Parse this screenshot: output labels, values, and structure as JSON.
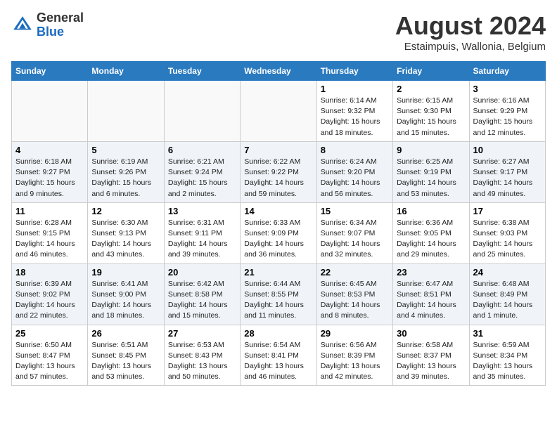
{
  "header": {
    "logo_general": "General",
    "logo_blue": "Blue",
    "month_year": "August 2024",
    "location": "Estaimpuis, Wallonia, Belgium"
  },
  "weekdays": [
    "Sunday",
    "Monday",
    "Tuesday",
    "Wednesday",
    "Thursday",
    "Friday",
    "Saturday"
  ],
  "weeks": [
    [
      {
        "day": "",
        "info": ""
      },
      {
        "day": "",
        "info": ""
      },
      {
        "day": "",
        "info": ""
      },
      {
        "day": "",
        "info": ""
      },
      {
        "day": "1",
        "info": "Sunrise: 6:14 AM\nSunset: 9:32 PM\nDaylight: 15 hours\nand 18 minutes."
      },
      {
        "day": "2",
        "info": "Sunrise: 6:15 AM\nSunset: 9:30 PM\nDaylight: 15 hours\nand 15 minutes."
      },
      {
        "day": "3",
        "info": "Sunrise: 6:16 AM\nSunset: 9:29 PM\nDaylight: 15 hours\nand 12 minutes."
      }
    ],
    [
      {
        "day": "4",
        "info": "Sunrise: 6:18 AM\nSunset: 9:27 PM\nDaylight: 15 hours\nand 9 minutes."
      },
      {
        "day": "5",
        "info": "Sunrise: 6:19 AM\nSunset: 9:26 PM\nDaylight: 15 hours\nand 6 minutes."
      },
      {
        "day": "6",
        "info": "Sunrise: 6:21 AM\nSunset: 9:24 PM\nDaylight: 15 hours\nand 2 minutes."
      },
      {
        "day": "7",
        "info": "Sunrise: 6:22 AM\nSunset: 9:22 PM\nDaylight: 14 hours\nand 59 minutes."
      },
      {
        "day": "8",
        "info": "Sunrise: 6:24 AM\nSunset: 9:20 PM\nDaylight: 14 hours\nand 56 minutes."
      },
      {
        "day": "9",
        "info": "Sunrise: 6:25 AM\nSunset: 9:19 PM\nDaylight: 14 hours\nand 53 minutes."
      },
      {
        "day": "10",
        "info": "Sunrise: 6:27 AM\nSunset: 9:17 PM\nDaylight: 14 hours\nand 49 minutes."
      }
    ],
    [
      {
        "day": "11",
        "info": "Sunrise: 6:28 AM\nSunset: 9:15 PM\nDaylight: 14 hours\nand 46 minutes."
      },
      {
        "day": "12",
        "info": "Sunrise: 6:30 AM\nSunset: 9:13 PM\nDaylight: 14 hours\nand 43 minutes."
      },
      {
        "day": "13",
        "info": "Sunrise: 6:31 AM\nSunset: 9:11 PM\nDaylight: 14 hours\nand 39 minutes."
      },
      {
        "day": "14",
        "info": "Sunrise: 6:33 AM\nSunset: 9:09 PM\nDaylight: 14 hours\nand 36 minutes."
      },
      {
        "day": "15",
        "info": "Sunrise: 6:34 AM\nSunset: 9:07 PM\nDaylight: 14 hours\nand 32 minutes."
      },
      {
        "day": "16",
        "info": "Sunrise: 6:36 AM\nSunset: 9:05 PM\nDaylight: 14 hours\nand 29 minutes."
      },
      {
        "day": "17",
        "info": "Sunrise: 6:38 AM\nSunset: 9:03 PM\nDaylight: 14 hours\nand 25 minutes."
      }
    ],
    [
      {
        "day": "18",
        "info": "Sunrise: 6:39 AM\nSunset: 9:02 PM\nDaylight: 14 hours\nand 22 minutes."
      },
      {
        "day": "19",
        "info": "Sunrise: 6:41 AM\nSunset: 9:00 PM\nDaylight: 14 hours\nand 18 minutes."
      },
      {
        "day": "20",
        "info": "Sunrise: 6:42 AM\nSunset: 8:58 PM\nDaylight: 14 hours\nand 15 minutes."
      },
      {
        "day": "21",
        "info": "Sunrise: 6:44 AM\nSunset: 8:55 PM\nDaylight: 14 hours\nand 11 minutes."
      },
      {
        "day": "22",
        "info": "Sunrise: 6:45 AM\nSunset: 8:53 PM\nDaylight: 14 hours\nand 8 minutes."
      },
      {
        "day": "23",
        "info": "Sunrise: 6:47 AM\nSunset: 8:51 PM\nDaylight: 14 hours\nand 4 minutes."
      },
      {
        "day": "24",
        "info": "Sunrise: 6:48 AM\nSunset: 8:49 PM\nDaylight: 14 hours\nand 1 minute."
      }
    ],
    [
      {
        "day": "25",
        "info": "Sunrise: 6:50 AM\nSunset: 8:47 PM\nDaylight: 13 hours\nand 57 minutes."
      },
      {
        "day": "26",
        "info": "Sunrise: 6:51 AM\nSunset: 8:45 PM\nDaylight: 13 hours\nand 53 minutes."
      },
      {
        "day": "27",
        "info": "Sunrise: 6:53 AM\nSunset: 8:43 PM\nDaylight: 13 hours\nand 50 minutes."
      },
      {
        "day": "28",
        "info": "Sunrise: 6:54 AM\nSunset: 8:41 PM\nDaylight: 13 hours\nand 46 minutes."
      },
      {
        "day": "29",
        "info": "Sunrise: 6:56 AM\nSunset: 8:39 PM\nDaylight: 13 hours\nand 42 minutes."
      },
      {
        "day": "30",
        "info": "Sunrise: 6:58 AM\nSunset: 8:37 PM\nDaylight: 13 hours\nand 39 minutes."
      },
      {
        "day": "31",
        "info": "Sunrise: 6:59 AM\nSunset: 8:34 PM\nDaylight: 13 hours\nand 35 minutes."
      }
    ]
  ]
}
